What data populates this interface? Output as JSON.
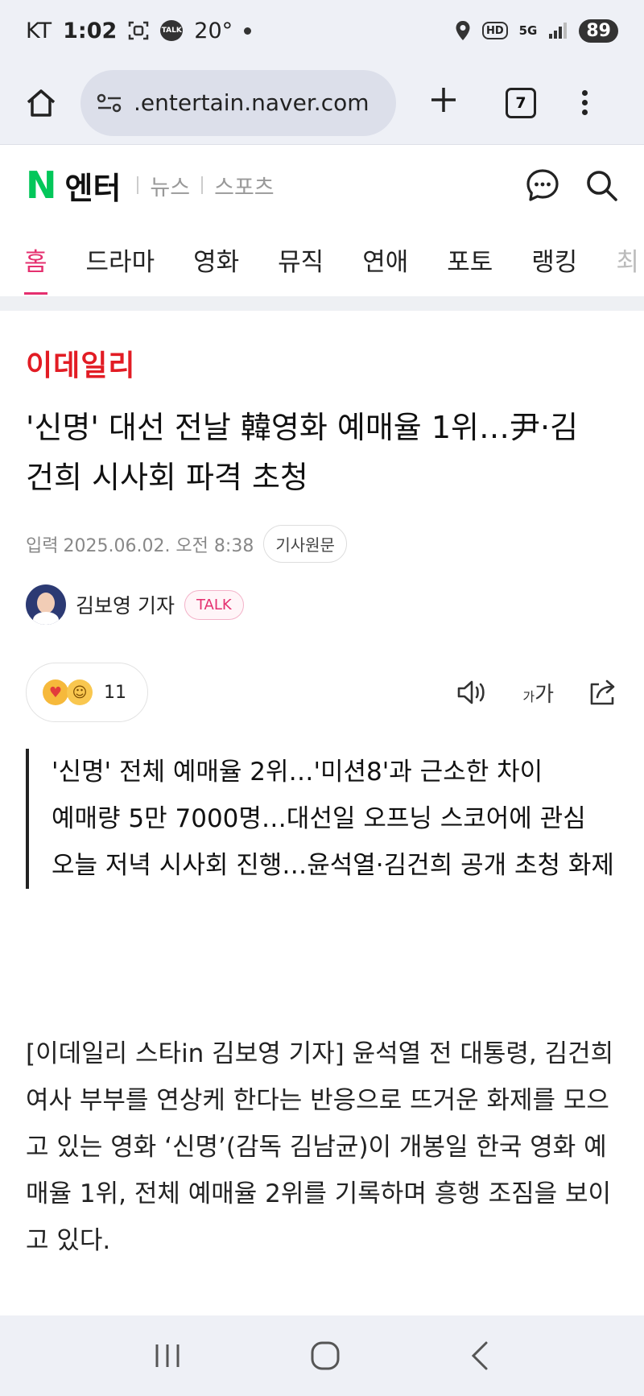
{
  "status_bar": {
    "carrier": "KT",
    "time": "1:02",
    "talk_badge": "TALK",
    "temperature": "20°",
    "network": "5G",
    "hd": "HD",
    "battery": "89"
  },
  "browser": {
    "url": ".entertain.naver.com",
    "tab_count": "7",
    "icons": [
      "home-icon",
      "site-info-icon",
      "plus-icon",
      "tabs-icon",
      "more-vert-icon"
    ]
  },
  "header": {
    "logo": "N",
    "service": "엔터",
    "links": [
      "뉴스",
      "스포츠"
    ],
    "icons": [
      "chat-icon",
      "search-icon"
    ]
  },
  "categories": [
    {
      "label": "홈",
      "active": true
    },
    {
      "label": "드라마",
      "active": false
    },
    {
      "label": "영화",
      "active": false
    },
    {
      "label": "뮤직",
      "active": false
    },
    {
      "label": "연애",
      "active": false
    },
    {
      "label": "포토",
      "active": false
    },
    {
      "label": "랭킹",
      "active": false
    },
    {
      "label": "최",
      "active": false
    }
  ],
  "article": {
    "press": "이데일리",
    "title": "'신명' 대선 전날 韓영화 예매율 1위…尹·김건희 시사회 파격 초청",
    "meta_label": "입력",
    "date": "2025.06.02. 오전 8:38",
    "origin_button": "기사원문",
    "reporter": "김보영 기자",
    "talk": "TALK",
    "reaction_count": "11",
    "font_size_label_small": "가",
    "font_size_label_large": "가",
    "summary": [
      "'신명' 전체 예매율 2위…'미션8'과 근소한 차이",
      "예매량 5만 7000명…대선일 오프닝 스코어에 관심",
      "오늘 저녁 시사회 진행…윤석열·김건희 공개 초청 화제"
    ],
    "body": "[이데일리 스타in 김보영 기자] 윤석열 전 대통령, 김건희 여사 부부를 연상케 한다는 반응으로 뜨거운 화제를 모으고 있는 영화 ‘신명’(감독 김남균)이 개봉일 한국 영화 예매율 1위, 전체 예매율 2위를 기록하며 흥행 조짐을 보이고 있다."
  },
  "colors": {
    "accent": "#e5306f",
    "naver_green": "#03c75a",
    "press_red": "#e21c24"
  }
}
